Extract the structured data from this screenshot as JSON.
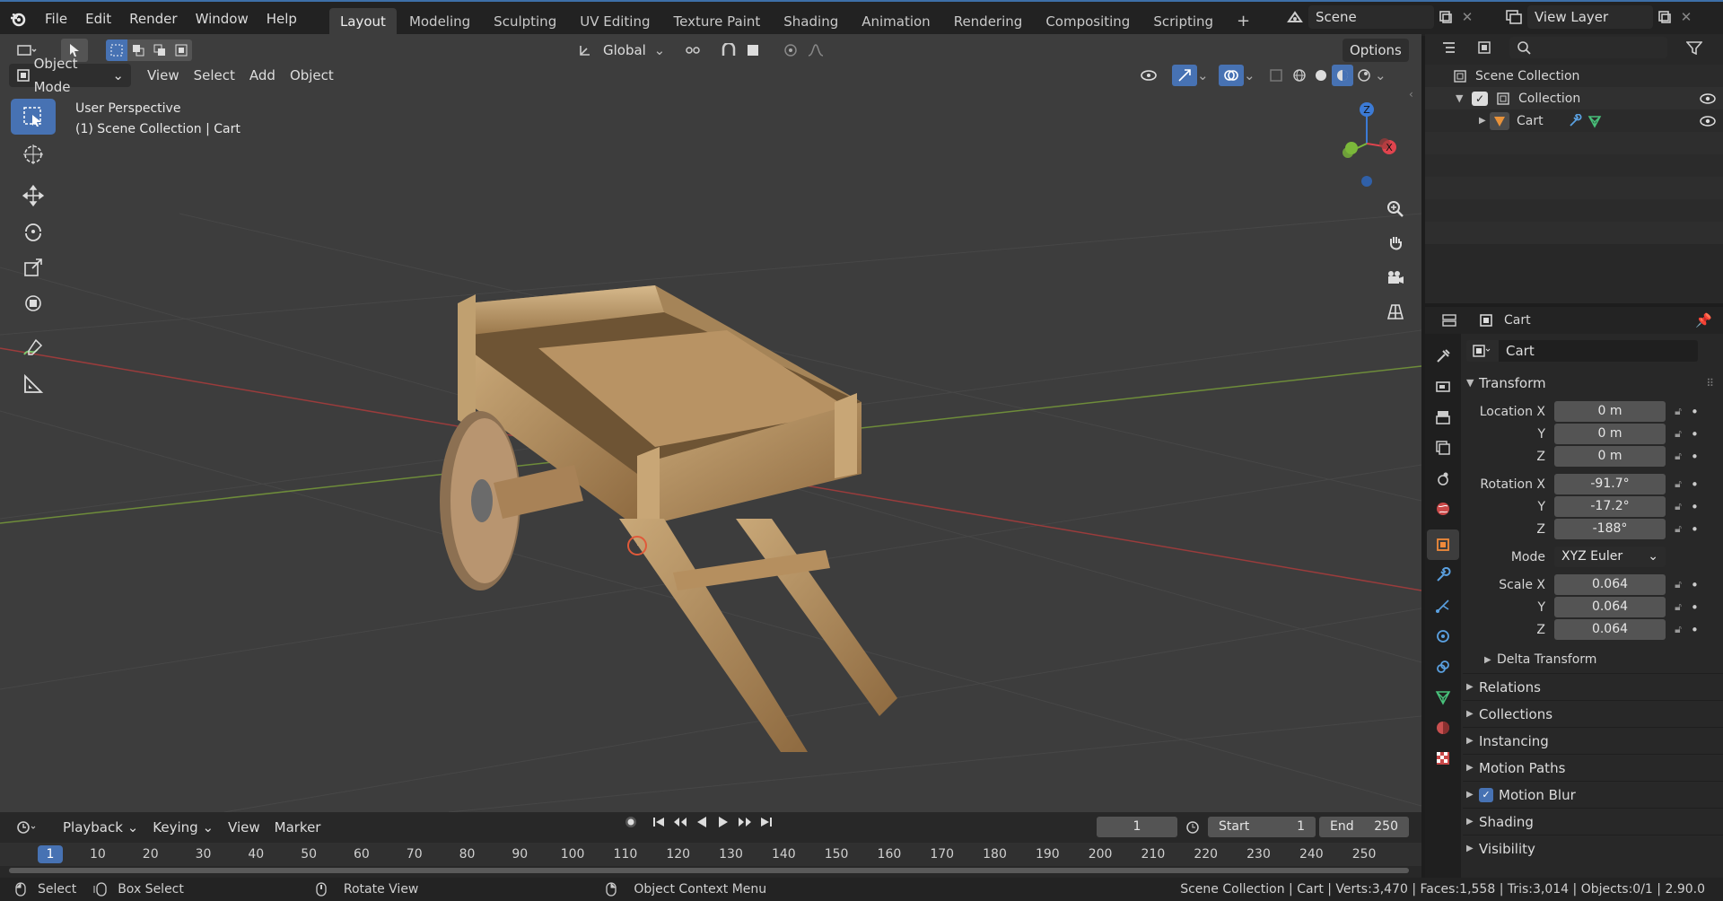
{
  "topbar": {
    "menus": [
      "File",
      "Edit",
      "Render",
      "Window",
      "Help"
    ],
    "workspaces": [
      "Layout",
      "Modeling",
      "Sculpting",
      "UV Editing",
      "Texture Paint",
      "Shading",
      "Animation",
      "Rendering",
      "Compositing",
      "Scripting"
    ],
    "add_tab": "+",
    "scene": "Scene",
    "view_layer": "View Layer"
  },
  "viewport": {
    "mode": "Object Mode",
    "menus": [
      "View",
      "Select",
      "Add",
      "Object"
    ],
    "orientation": "Global",
    "options": "Options",
    "overlay_line1": "User Perspective",
    "overlay_line2": "(1) Scene Collection | Cart",
    "gizmo": {
      "z": "Z",
      "x": "X"
    }
  },
  "outliner": {
    "root": "Scene Collection",
    "collection": "Collection",
    "object": "Cart"
  },
  "properties": {
    "header_object": "Cart",
    "object_name": "Cart",
    "transform_title": "Transform",
    "location": {
      "label": "Location X",
      "x": "0 m",
      "y": "0 m",
      "z": "0 m"
    },
    "rotation": {
      "label": "Rotation X",
      "x": "-91.7°",
      "y": "-17.2°",
      "z": "-188°"
    },
    "mode_label": "Mode",
    "mode_value": "XYZ Euler",
    "scale": {
      "label": "Scale X",
      "x": "0.064",
      "y": "0.064",
      "z": "0.064"
    },
    "axis_y": "Y",
    "axis_z": "Z",
    "delta": "Delta Transform",
    "panels": [
      "Relations",
      "Collections",
      "Instancing",
      "Motion Paths",
      "Motion Blur",
      "Shading",
      "Visibility"
    ]
  },
  "timeline": {
    "menus": [
      "Playback",
      "Keying",
      "View",
      "Marker"
    ],
    "current": "1",
    "start_label": "Start",
    "start": "1",
    "end_label": "End",
    "end": "250",
    "ticks": [
      "1",
      "10",
      "20",
      "30",
      "40",
      "50",
      "60",
      "70",
      "80",
      "90",
      "100",
      "110",
      "120",
      "130",
      "140",
      "150",
      "160",
      "170",
      "180",
      "190",
      "200",
      "210",
      "220",
      "230",
      "240",
      "250"
    ]
  },
  "status": {
    "select": "Select",
    "box_select": "Box Select",
    "rotate": "Rotate View",
    "context": "Object Context Menu",
    "stats": "Scene Collection | Cart | Verts:3,470 | Faces:1,558 | Tris:3,014 | Objects:0/1 | 2.90.0"
  },
  "colors": {
    "accent": "#4772b3",
    "x_axis": "#e0444e",
    "y_axis": "#7bb83a",
    "z_axis": "#3c7bd6"
  }
}
